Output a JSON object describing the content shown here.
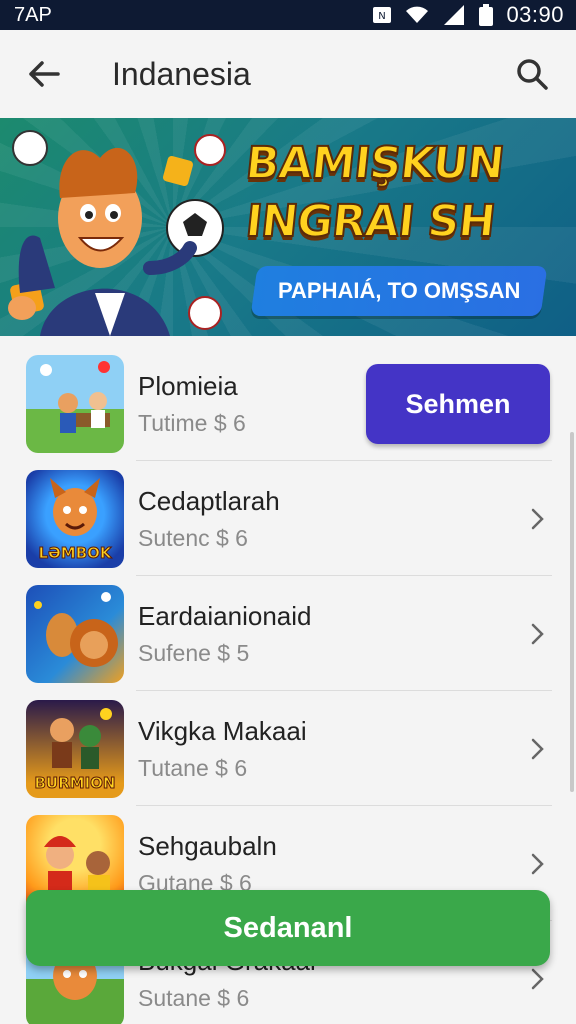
{
  "status_bar": {
    "carrier": "7AP",
    "time": "03:90"
  },
  "app_bar": {
    "title": "Indanesia"
  },
  "banner": {
    "line1": "BAMIŞKUN",
    "line2": "INGRAI SH",
    "subtitle": "PAPHAIÁ, TO OMŞSAN"
  },
  "list": [
    {
      "name": "Plomieia",
      "meta": "Tutime $ 6",
      "action_label": "Sehmen",
      "thumb_label": ""
    },
    {
      "name": "Cedaptlarah",
      "meta": "Sutenc $ 6",
      "thumb_label": "LƏMBOK"
    },
    {
      "name": "Eardaianionaid",
      "meta": "Sufene $ 5",
      "thumb_label": ""
    },
    {
      "name": "Vikgka Makaai",
      "meta": "Tutane $ 6",
      "thumb_label": "BURMION"
    },
    {
      "name": "Sehgaubaln",
      "meta": "Gutane $ 6",
      "thumb_label": ""
    },
    {
      "name": "Bukgai Grakaai",
      "meta": "Sutane $ 6",
      "thumb_label": ""
    }
  ],
  "bottom_button": {
    "label": "Sedananl"
  },
  "colors": {
    "status_bar": "#0e1a33",
    "primary": "#4434c6",
    "accent_green": "#3aa84a",
    "banner_text": "#ffd21f"
  }
}
